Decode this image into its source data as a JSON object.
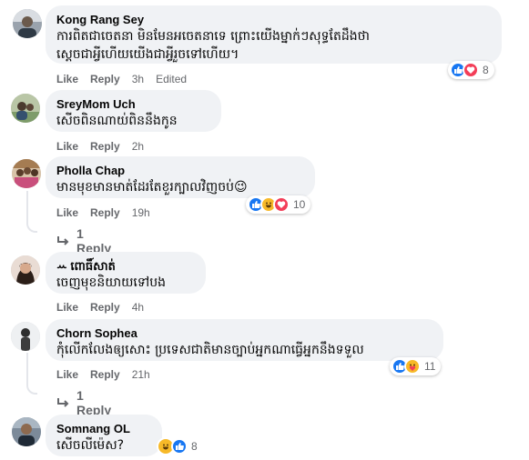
{
  "labels": {
    "like": "Like",
    "reply": "Reply"
  },
  "colors": {
    "like_blue": "#1877f2",
    "love_red": "#f33e58",
    "haha_yellow": "#f7b928",
    "bubble_bg": "#f0f2f5",
    "meta_gray": "#65676b"
  },
  "comments": [
    {
      "author": "Kong Rang Sey",
      "text_lines": [
        "ការពិតជាចេតនា មិនមែនអចេតនាទេ ព្រោះយើងម្នាក់ៗសុទ្ធតែដឹងថា",
        "ស្តេចជាអ្វីហើយយើងជាអ្វីរួចទៅហើយ។"
      ],
      "time": "3h",
      "edited": "Edited",
      "reactions": [
        "like",
        "love"
      ],
      "reaction_count": "8"
    },
    {
      "author": "SreyMom Uch",
      "text_lines": [
        "សើចពិនណាយ់ពិននឹងកូន"
      ],
      "time": "2h"
    },
    {
      "author": "Pholla Chap",
      "text_lines": [
        "មានមុខមានមាត់ដែរតែខួរក្បាលវិញចប់😉"
      ],
      "time": "19h",
      "reactions": [
        "like",
        "haha",
        "love"
      ],
      "reaction_count": "10",
      "replies": "1 Reply"
    },
    {
      "author": "ꕀ ពោធិ៍សាត់",
      "text_lines": [
        "ចេញមុខនិយាយទៅបង"
      ],
      "time": "4h"
    },
    {
      "author": "Chorn Sophea",
      "text_lines": [
        "កុំលើកលែងឲ្យសោះ ប្រទេសជាតិមានច្បាប់អ្នកណាធ្វើអ្នកនឹងទទួល"
      ],
      "time": "21h",
      "reactions": [
        "like",
        "care"
      ],
      "reaction_count": "11",
      "replies": "1 Reply"
    },
    {
      "author": "Somnang OL",
      "text_lines": [
        "សើចលីម៉េស?"
      ],
      "emoji_reactions": [
        "haha",
        "like"
      ],
      "reaction_count": "8"
    }
  ]
}
